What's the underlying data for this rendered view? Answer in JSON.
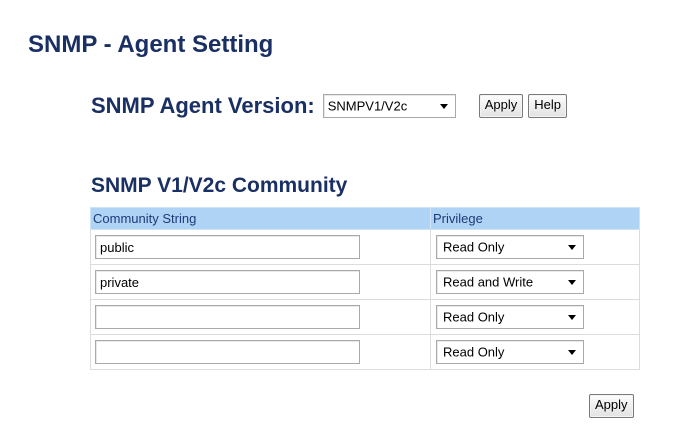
{
  "page": {
    "title": "SNMP - Agent Setting"
  },
  "agent": {
    "label": "SNMP Agent Version:",
    "version_selected": "SNMPV1/V2c",
    "apply_label": "Apply",
    "help_label": "Help"
  },
  "community": {
    "title": "SNMP V1/V2c Community",
    "headers": {
      "string": "Community String",
      "privilege": "Privilege"
    },
    "rows": [
      {
        "string": "public",
        "privilege": "Read Only"
      },
      {
        "string": "private",
        "privilege": "Read and Write"
      },
      {
        "string": "",
        "privilege": "Read Only"
      },
      {
        "string": "",
        "privilege": "Read Only"
      }
    ],
    "apply_label": "Apply"
  },
  "icons": {
    "dropdown": "chevron-down-icon"
  },
  "colors": {
    "heading": "#1a2f63",
    "table_header_bg": "#aed3f5",
    "table_header_text": "#1f3a78"
  }
}
